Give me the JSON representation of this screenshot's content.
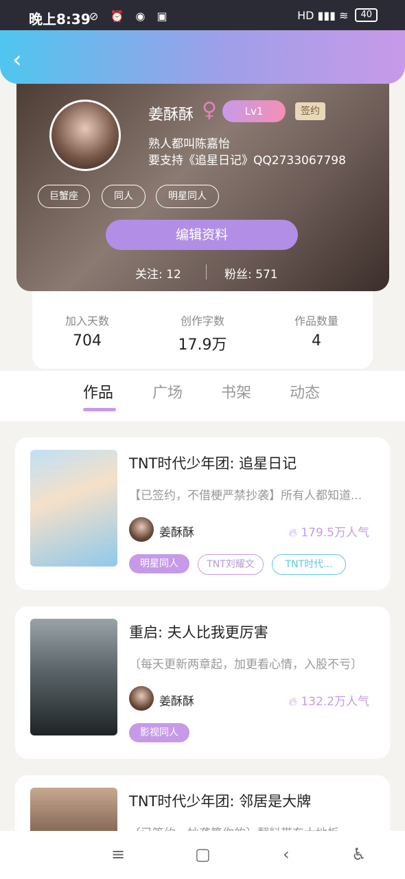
{
  "status": {
    "time": "晚上8:39",
    "left_icons": "⊘ ⏰ ◉ ▣",
    "right_icons": "HD ▮▮▮ ≋",
    "battery": "40"
  },
  "header": {
    "back": "‹"
  },
  "profile": {
    "name": "姜酥酥",
    "gender": "♀",
    "level": "Lv1",
    "signed": "签约",
    "bio_line1": "熟人都叫陈嘉怡",
    "bio_line2": "要支持《追星日记》QQ2733067798",
    "tags": [
      "巨蟹座",
      "同人",
      "明星同人"
    ],
    "edit_label": "编辑资料",
    "following": "关注: 12",
    "fans": "粉丝: 571"
  },
  "stats": [
    {
      "label": "加入天数",
      "value": "704"
    },
    {
      "label": "创作字数",
      "value": "17.9万"
    },
    {
      "label": "作品数量",
      "value": "4"
    }
  ],
  "tabs": [
    "作品",
    "广场",
    "书架",
    "动态"
  ],
  "works": [
    {
      "title": "TNT时代少年团: 追星日记",
      "desc": "【已签约，不借梗严禁抄袭】所有人都知道...",
      "author": "姜酥酥",
      "popularity": "179.5万人气",
      "tags": [
        "明星同人",
        "TNT刘耀文",
        "TNT时代..."
      ]
    },
    {
      "title": "重启: 夫人比我更厉害",
      "desc": "〔每天更新两章起，加更看心情，入股不亏〕",
      "author": "姜酥酥",
      "popularity": "132.2万人气",
      "tags": [
        "影视同人"
      ]
    },
    {
      "title": "TNT时代少年团: 邻居是大牌",
      "desc": "〔已签约，抄袭算你的〕翻料带东大地板",
      "author": "",
      "popularity": "",
      "tags": []
    }
  ],
  "navbar": {
    "menu": "≡",
    "home": "▢",
    "back": "‹",
    "access": "♿"
  }
}
